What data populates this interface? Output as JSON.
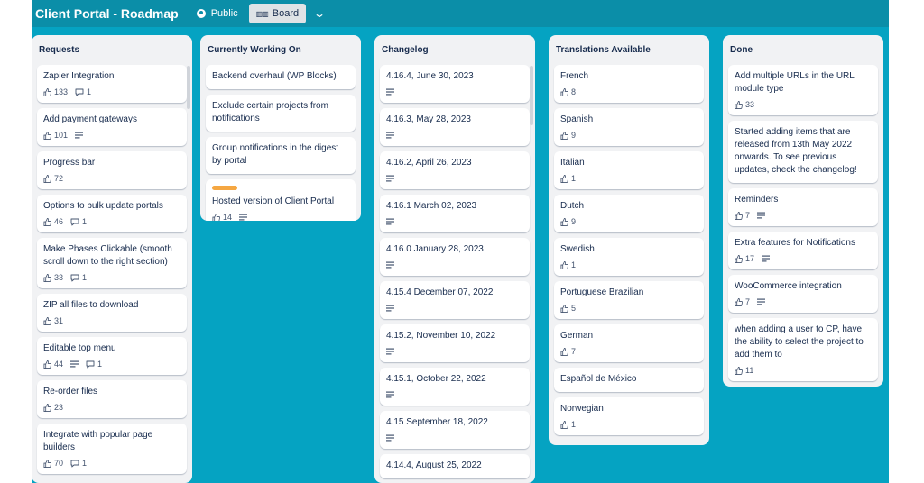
{
  "header": {
    "board_title": "Client Portal - Roadmap",
    "visibility": "Public",
    "visibility_icon": "globe-icon",
    "view": "Board",
    "view_icon": "board-icon",
    "view_menu_icon": "chevron-down-icon"
  },
  "colors": {
    "board_bg": "#05a3c2",
    "header_bg": "#0b8ea8",
    "list_bg": "#f1f2f4",
    "label_orange": "#f5a742"
  },
  "lists": [
    {
      "title": "Requests",
      "cards": [
        {
          "title": "Zapier Integration",
          "likes": "133",
          "comments": "1"
        },
        {
          "title": "Add payment gateways",
          "likes": "101",
          "description": true
        },
        {
          "title": "Progress bar",
          "likes": "72"
        },
        {
          "title": "Options to bulk update portals",
          "likes": "46",
          "comments": "1"
        },
        {
          "title": "Make Phases Clickable (smooth scroll down to the right section)",
          "likes": "33",
          "comments": "1"
        },
        {
          "title": "ZIP all files to download",
          "likes": "31"
        },
        {
          "title": "Editable top menu",
          "likes": "44",
          "description": true,
          "comments": "1"
        },
        {
          "title": "Re-order files",
          "likes": "23"
        },
        {
          "title": "Integrate with popular page builders",
          "likes": "70",
          "comments": "1"
        }
      ]
    },
    {
      "title": "Currently Working On",
      "cards": [
        {
          "title": "Backend overhaul (WP Blocks)"
        },
        {
          "title": "Exclude certain projects from notifications"
        },
        {
          "title": "Group notifications in the digest by portal"
        },
        {
          "title": "Hosted version of Client Portal",
          "label": "orange",
          "likes": "14",
          "description": true
        }
      ]
    },
    {
      "title": "Changelog",
      "cards": [
        {
          "title": "4.16.4, June 30, 2023",
          "description": true
        },
        {
          "title": "4.16.3, May 28, 2023",
          "description": true
        },
        {
          "title": "4.16.2, April 26, 2023",
          "description": true
        },
        {
          "title": "4.16.1 March 02, 2023",
          "description": true
        },
        {
          "title": "4.16.0 January 28, 2023",
          "description": true
        },
        {
          "title": "4.15.4 December 07, 2022",
          "description": true
        },
        {
          "title": "4.15.2, November 10, 2022",
          "description": true
        },
        {
          "title": "4.15.1, October 22, 2022",
          "description": true
        },
        {
          "title": "4.15 September 18, 2022",
          "description": true
        },
        {
          "title": "4.14.4, August 25, 2022"
        }
      ]
    },
    {
      "title": "Translations Available",
      "cards": [
        {
          "title": "French",
          "likes": "8"
        },
        {
          "title": "Spanish",
          "likes": "9"
        },
        {
          "title": "Italian",
          "likes": "1"
        },
        {
          "title": "Dutch",
          "likes": "9"
        },
        {
          "title": "Swedish",
          "likes": "1"
        },
        {
          "title": "Portuguese Brazilian",
          "likes": "5"
        },
        {
          "title": "German",
          "likes": "7"
        },
        {
          "title": "Español de México"
        },
        {
          "title": "Norwegian",
          "likes": "1"
        }
      ]
    },
    {
      "title": "Done",
      "cards": [
        {
          "title": "Add multiple URLs in the URL module type",
          "likes": "33"
        },
        {
          "title": "Started adding items that are released from 13th May 2022 onwards. To see previous updates, check the changelog!"
        },
        {
          "title": "Reminders",
          "likes": "7",
          "description": true
        },
        {
          "title": "Extra features for Notifications",
          "likes": "17",
          "description": true
        },
        {
          "title": "WooCommerce integration",
          "likes": "7",
          "description": true
        },
        {
          "title": "when adding a user to CP, have the ability to select the project to add them to",
          "likes": "11"
        }
      ]
    }
  ]
}
